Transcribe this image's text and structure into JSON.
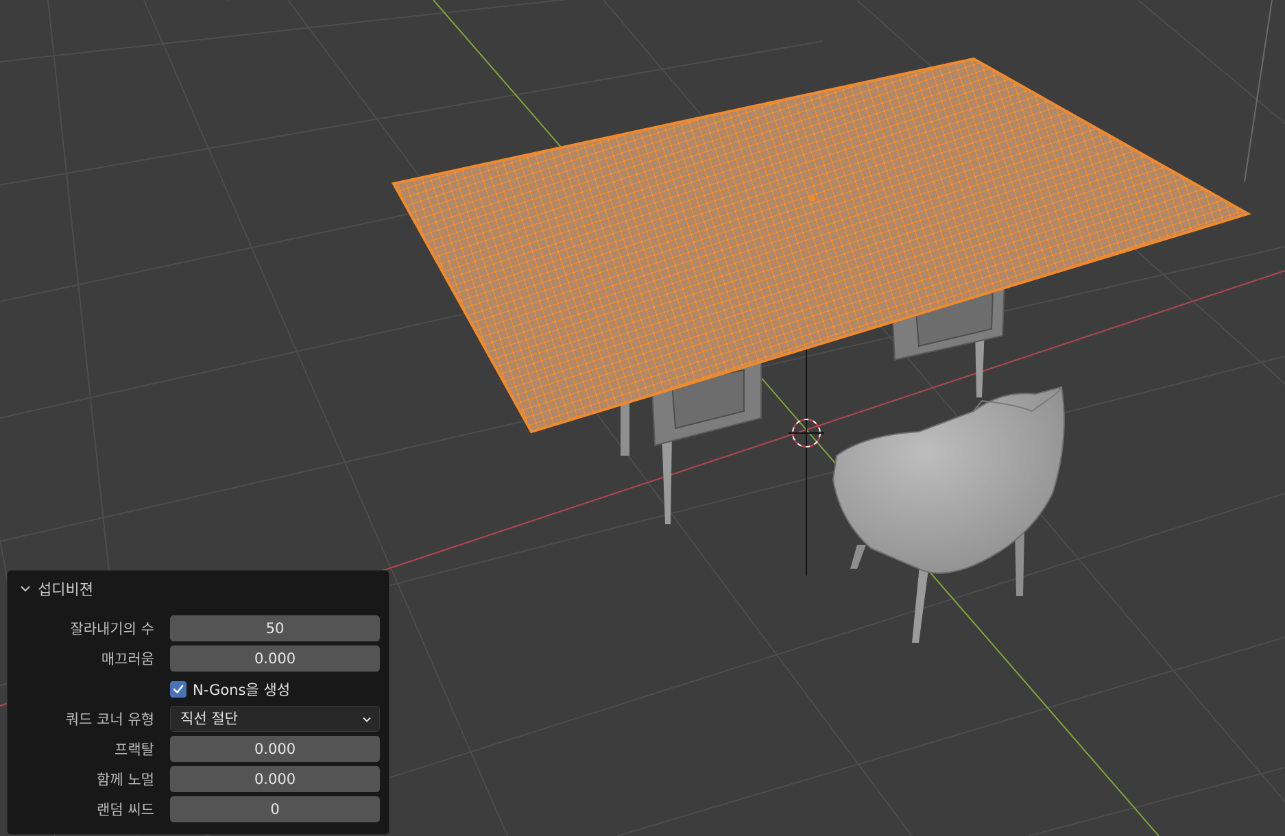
{
  "scene": {
    "mesh_color": "#f08a2e",
    "grid_color": "#4a4a4a",
    "background": "#3d3d3d",
    "x_axis_color": "#b4454f",
    "y_axis_color": "#7ea53a"
  },
  "panel": {
    "title": "섭디비젼",
    "collapse_icon": "chevron-down-icon",
    "fields": {
      "cuts": {
        "label": "잘라내기의 수",
        "value": "50"
      },
      "smoothness": {
        "label": "매끄러움",
        "value": "0.000"
      },
      "ngons": {
        "label": "N-Gons을 생성",
        "checked": true
      },
      "quad_corner": {
        "label": "쿼드 코너 유형",
        "value": "직선 절단"
      },
      "fractal": {
        "label": "프랙탈",
        "value": "0.000"
      },
      "along_normal": {
        "label": "함께 노멀",
        "value": "0.000"
      },
      "seed": {
        "label": "랜덤 씨드",
        "value": "0"
      }
    }
  }
}
